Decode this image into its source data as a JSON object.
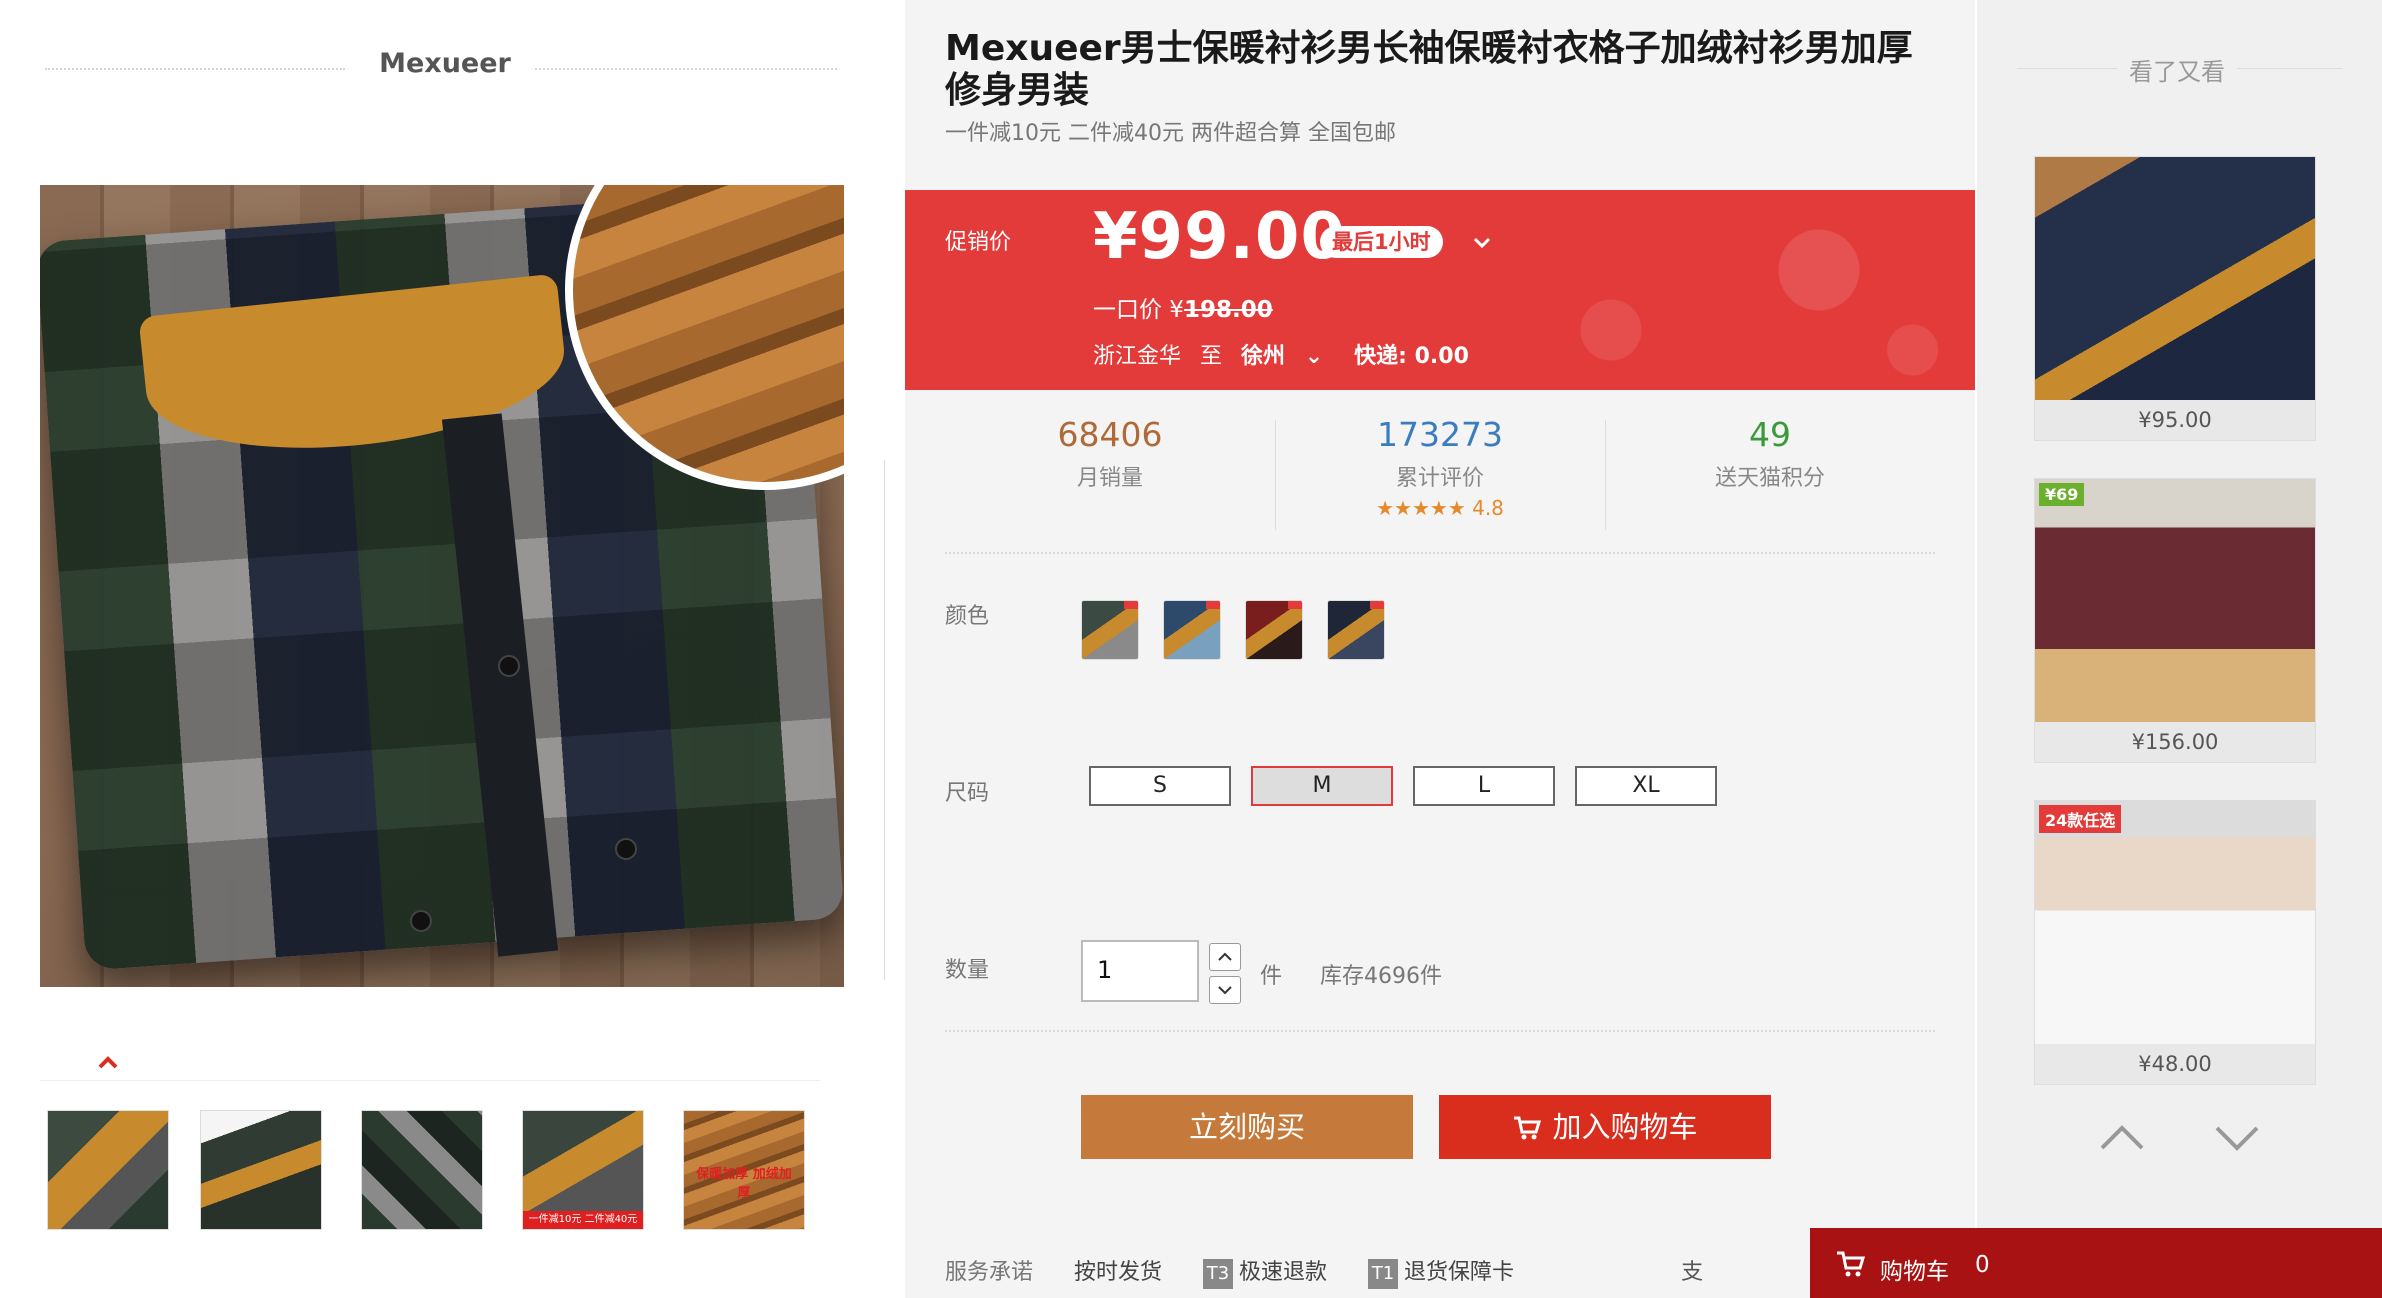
{
  "gallery": {
    "brand": "Mexueer",
    "thumb_badges": [
      "",
      "",
      "",
      "一件减10元 二件减40元",
      "保暖加厚 加绒加厚"
    ]
  },
  "product": {
    "title": "Mexueer男士保暖衬衫男长袖保暖衬衣格子加绒衬衫男加厚修身男装",
    "subtitle": "一件减10元 二件减40元 两件超合算 全国包邮"
  },
  "price": {
    "promo_label": "促销价",
    "value": "¥99.00",
    "tag": "最后1小时",
    "original_label": "一口价 ¥",
    "original_value": "198.00",
    "ship_from": "浙江金华",
    "ship_to_word": "至",
    "ship_city": "徐州",
    "express": "快递: 0.00"
  },
  "stats": [
    {
      "value": "68406",
      "label": "月销量",
      "color": "#b06a3a"
    },
    {
      "value": "173273",
      "label": "累计评价",
      "color": "#3a7cc0",
      "rating": "★★★★★ 4.8"
    },
    {
      "value": "49",
      "label": "送天猫积分",
      "color": "#3a9a3a"
    }
  ],
  "options": {
    "color_label": "颜色",
    "size_label": "尺码",
    "sizes": [
      "S",
      "M",
      "L",
      "XL"
    ],
    "selected_size": "M"
  },
  "quantity": {
    "label": "数量",
    "value": "1",
    "unit": "件",
    "stock": "库存4696件"
  },
  "actions": {
    "buy_now": "立刻购买",
    "add_cart": "加入购物车"
  },
  "service": {
    "label": "服务承诺",
    "items": [
      {
        "tag": "",
        "text": "按时发货"
      },
      {
        "tag": "T3",
        "text": "极速退款"
      },
      {
        "tag": "T1",
        "text": "退货保障卡"
      }
    ],
    "tail": "支"
  },
  "recommend": {
    "title": "看了又看",
    "items": [
      {
        "price": "¥95.00",
        "badge": ""
      },
      {
        "price": "¥156.00",
        "badge": "¥69"
      },
      {
        "price": "¥48.00",
        "badge": "24款任选"
      }
    ]
  },
  "cart": {
    "label": "购物车",
    "count": "0"
  },
  "colors": {
    "accent_red": "#e33a3a",
    "buy_button": "#c57a3c",
    "cart_button": "#d92d1e",
    "cart_bar": "#a91212"
  }
}
